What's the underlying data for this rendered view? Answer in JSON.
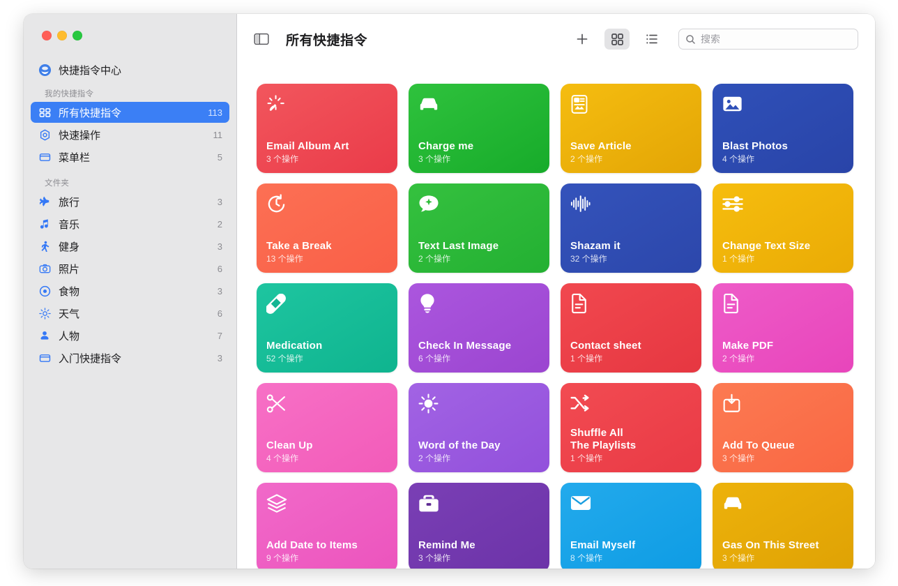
{
  "window": {
    "traffic_lights": [
      "close",
      "minimize",
      "zoom"
    ],
    "accent": "#3b7ff5"
  },
  "sidebar": {
    "hub": {
      "label": "快捷指令中心",
      "icon": "shortcuts-hub-icon"
    },
    "my_shortcuts_header": "我的快捷指令",
    "my_shortcuts": [
      {
        "label": "所有快捷指令",
        "count": "113",
        "icon": "all-shortcuts-icon",
        "selected": true
      },
      {
        "label": "快速操作",
        "count": "11",
        "icon": "quick-actions-icon",
        "selected": false
      },
      {
        "label": "菜单栏",
        "count": "5",
        "icon": "menu-bar-icon",
        "selected": false
      }
    ],
    "folders_header": "文件夹",
    "folders": [
      {
        "label": "旅行",
        "count": "3",
        "icon": "airplane-icon"
      },
      {
        "label": "音乐",
        "count": "2",
        "icon": "music-note-icon"
      },
      {
        "label": "健身",
        "count": "3",
        "icon": "fitness-icon"
      },
      {
        "label": "照片",
        "count": "6",
        "icon": "camera-icon"
      },
      {
        "label": "食物",
        "count": "3",
        "icon": "food-icon"
      },
      {
        "label": "天气",
        "count": "6",
        "icon": "weather-icon"
      },
      {
        "label": "人物",
        "count": "7",
        "icon": "person-icon"
      },
      {
        "label": "入门快捷指令",
        "count": "3",
        "icon": "starter-folder-icon"
      }
    ]
  },
  "toolbar": {
    "sidebar_toggle_icon": "sidebar-toggle-icon",
    "title": "所有快捷指令",
    "add_icon": "plus-icon",
    "grid_view_icon": "grid-view-icon",
    "list_view_icon": "list-view-icon",
    "search_icon": "search-icon",
    "search_placeholder": "搜索",
    "search_value": ""
  },
  "shortcuts": [
    {
      "name": "Email Album Art",
      "subtitle": "3 个操作",
      "icon": "sparkle-wand-icon",
      "color_start": "#f2565d",
      "color_end": "#ea3b49"
    },
    {
      "name": "Charge me",
      "subtitle": "3 个操作",
      "icon": "car-icon",
      "color_start": "#2fc23d",
      "color_end": "#17ab2a"
    },
    {
      "name": "Save Article",
      "subtitle": "2 个操作",
      "icon": "article-icon",
      "color_start": "#f5bd10",
      "color_end": "#e3a505"
    },
    {
      "name": "Blast Photos",
      "subtitle": "4 个操作",
      "icon": "photo-icon",
      "color_start": "#2f50b8",
      "color_end": "#2944a8"
    },
    {
      "name": "Take a Break",
      "subtitle": "13 个操作",
      "icon": "timer-icon",
      "color_start": "#fc7054",
      "color_end": "#f95f47"
    },
    {
      "name": "Text Last Image",
      "subtitle": "2 个操作",
      "icon": "message-sparkle-icon",
      "color_start": "#35c13f",
      "color_end": "#23b032"
    },
    {
      "name": "Shazam it",
      "subtitle": "32 个操作",
      "icon": "waveform-icon",
      "color_start": "#3453bb",
      "color_end": "#2c47ab"
    },
    {
      "name": "Change Text Size",
      "subtitle": "1 个操作",
      "icon": "sliders-icon",
      "color_start": "#f6bd0e",
      "color_end": "#eaab05"
    },
    {
      "name": "Medication",
      "subtitle": "52 个操作",
      "icon": "pill-icon",
      "color_start": "#1ec5a0",
      "color_end": "#0fb48f"
    },
    {
      "name": "Check In Message",
      "subtitle": "6 个操作",
      "icon": "lightbulb-icon",
      "color_start": "#ab56de",
      "color_end": "#9b45d0"
    },
    {
      "name": "Contact sheet",
      "subtitle": "1 个操作",
      "icon": "document-icon",
      "color_start": "#f1484f",
      "color_end": "#e63741"
    },
    {
      "name": "Make PDF",
      "subtitle": "2 个操作",
      "icon": "document-icon",
      "color_start": "#ee5bc8",
      "color_end": "#e845bb"
    },
    {
      "name": "Clean Up",
      "subtitle": "4 个操作",
      "icon": "scissors-icon",
      "color_start": "#f770c6",
      "color_end": "#f25bb9"
    },
    {
      "name": "Word of the Day",
      "subtitle": "2 个操作",
      "icon": "sun-icon",
      "color_start": "#a263e4",
      "color_end": "#9250db"
    },
    {
      "name": "Shuffle All\nThe Playlists",
      "subtitle": "1 个操作",
      "icon": "shuffle-icon",
      "color_start": "#f24b52",
      "color_end": "#e93a45"
    },
    {
      "name": "Add To Queue",
      "subtitle": "3 个操作",
      "icon": "add-queue-icon",
      "color_start": "#fc7a52",
      "color_end": "#f96743"
    },
    {
      "name": "Add Date to Items",
      "subtitle": "9 个操作",
      "icon": "layers-icon",
      "color_start": "#f169c9",
      "color_end": "#ec54bd"
    },
    {
      "name": "Remind Me",
      "subtitle": "3 个操作",
      "icon": "briefcase-icon",
      "color_start": "#7a3fb5",
      "color_end": "#6c33a8"
    },
    {
      "name": "Email Myself",
      "subtitle": "8 个操作",
      "icon": "envelope-icon",
      "color_start": "#23aaec",
      "color_end": "#0e9ce4"
    },
    {
      "name": "Gas On This Street",
      "subtitle": "3 个操作",
      "icon": "car-icon",
      "color_start": "#edb20b",
      "color_end": "#dfa204"
    }
  ]
}
